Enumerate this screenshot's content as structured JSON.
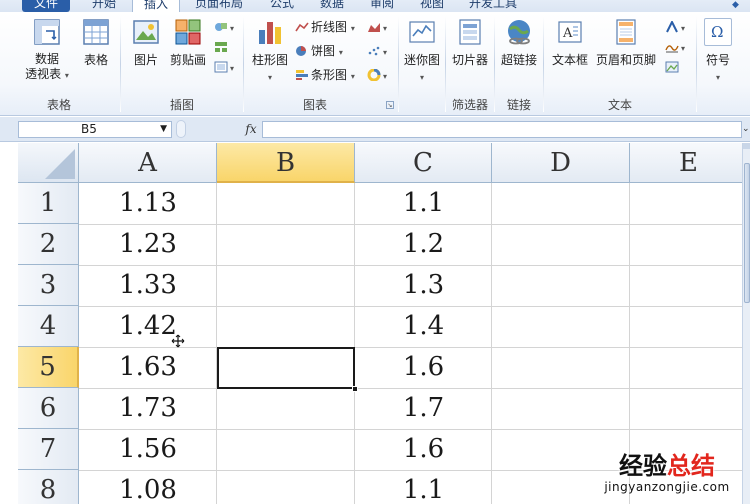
{
  "ribbon_tabs": [
    "文件",
    "开始",
    "插入",
    "页面布局",
    "公式",
    "数据",
    "审阅",
    "视图",
    "开发工具"
  ],
  "active_tab": "插入",
  "groups": {
    "tables": {
      "label": "表格",
      "pivot": "数据\n透视表",
      "pivot_line1": "数据",
      "pivot_line2": "透视表",
      "table": "表格"
    },
    "illustrations": {
      "label": "插图",
      "picture": "图片",
      "clipart": "剪贴画"
    },
    "charts": {
      "label": "图表",
      "column": "柱形图",
      "line": "折线图",
      "pie": "饼图",
      "bar": "条形图"
    },
    "sparklines": {
      "label": "",
      "sparkline": "迷你图"
    },
    "filter": {
      "label": "筛选器",
      "slicer": "切片器"
    },
    "links": {
      "label": "链接",
      "hyperlink": "超链接"
    },
    "text": {
      "label": "文本",
      "textbox": "文本框",
      "header_footer": "页眉和页脚"
    },
    "symbols": {
      "symbol": "符号"
    }
  },
  "formula_bar": {
    "name_box": "B5",
    "fx": "fx",
    "formula": ""
  },
  "columns": [
    "A",
    "B",
    "C",
    "D",
    "E"
  ],
  "selected_column": "B",
  "rows": [
    {
      "num": "1",
      "a": "1.13",
      "c": "1.1"
    },
    {
      "num": "2",
      "a": "1.23",
      "c": "1.2"
    },
    {
      "num": "3",
      "a": "1.33",
      "c": "1.3"
    },
    {
      "num": "4",
      "a": "1.42",
      "c": "1.4"
    },
    {
      "num": "5",
      "a": "1.63",
      "c": "1.6"
    },
    {
      "num": "6",
      "a": "1.73",
      "c": "1.7"
    },
    {
      "num": "7",
      "a": "1.56",
      "c": "1.6"
    },
    {
      "num": "8",
      "a": "1.08",
      "c": "1.1"
    }
  ],
  "selected_row": "5",
  "watermark": {
    "line1_a": "经验",
    "line1_b": "总结",
    "line2": "jingyanzongjie.com"
  },
  "colors": {
    "header_selected": "#f9d56a",
    "file_tab": "#2a5ea8",
    "ribbon_bg": "#f5f8fc"
  }
}
